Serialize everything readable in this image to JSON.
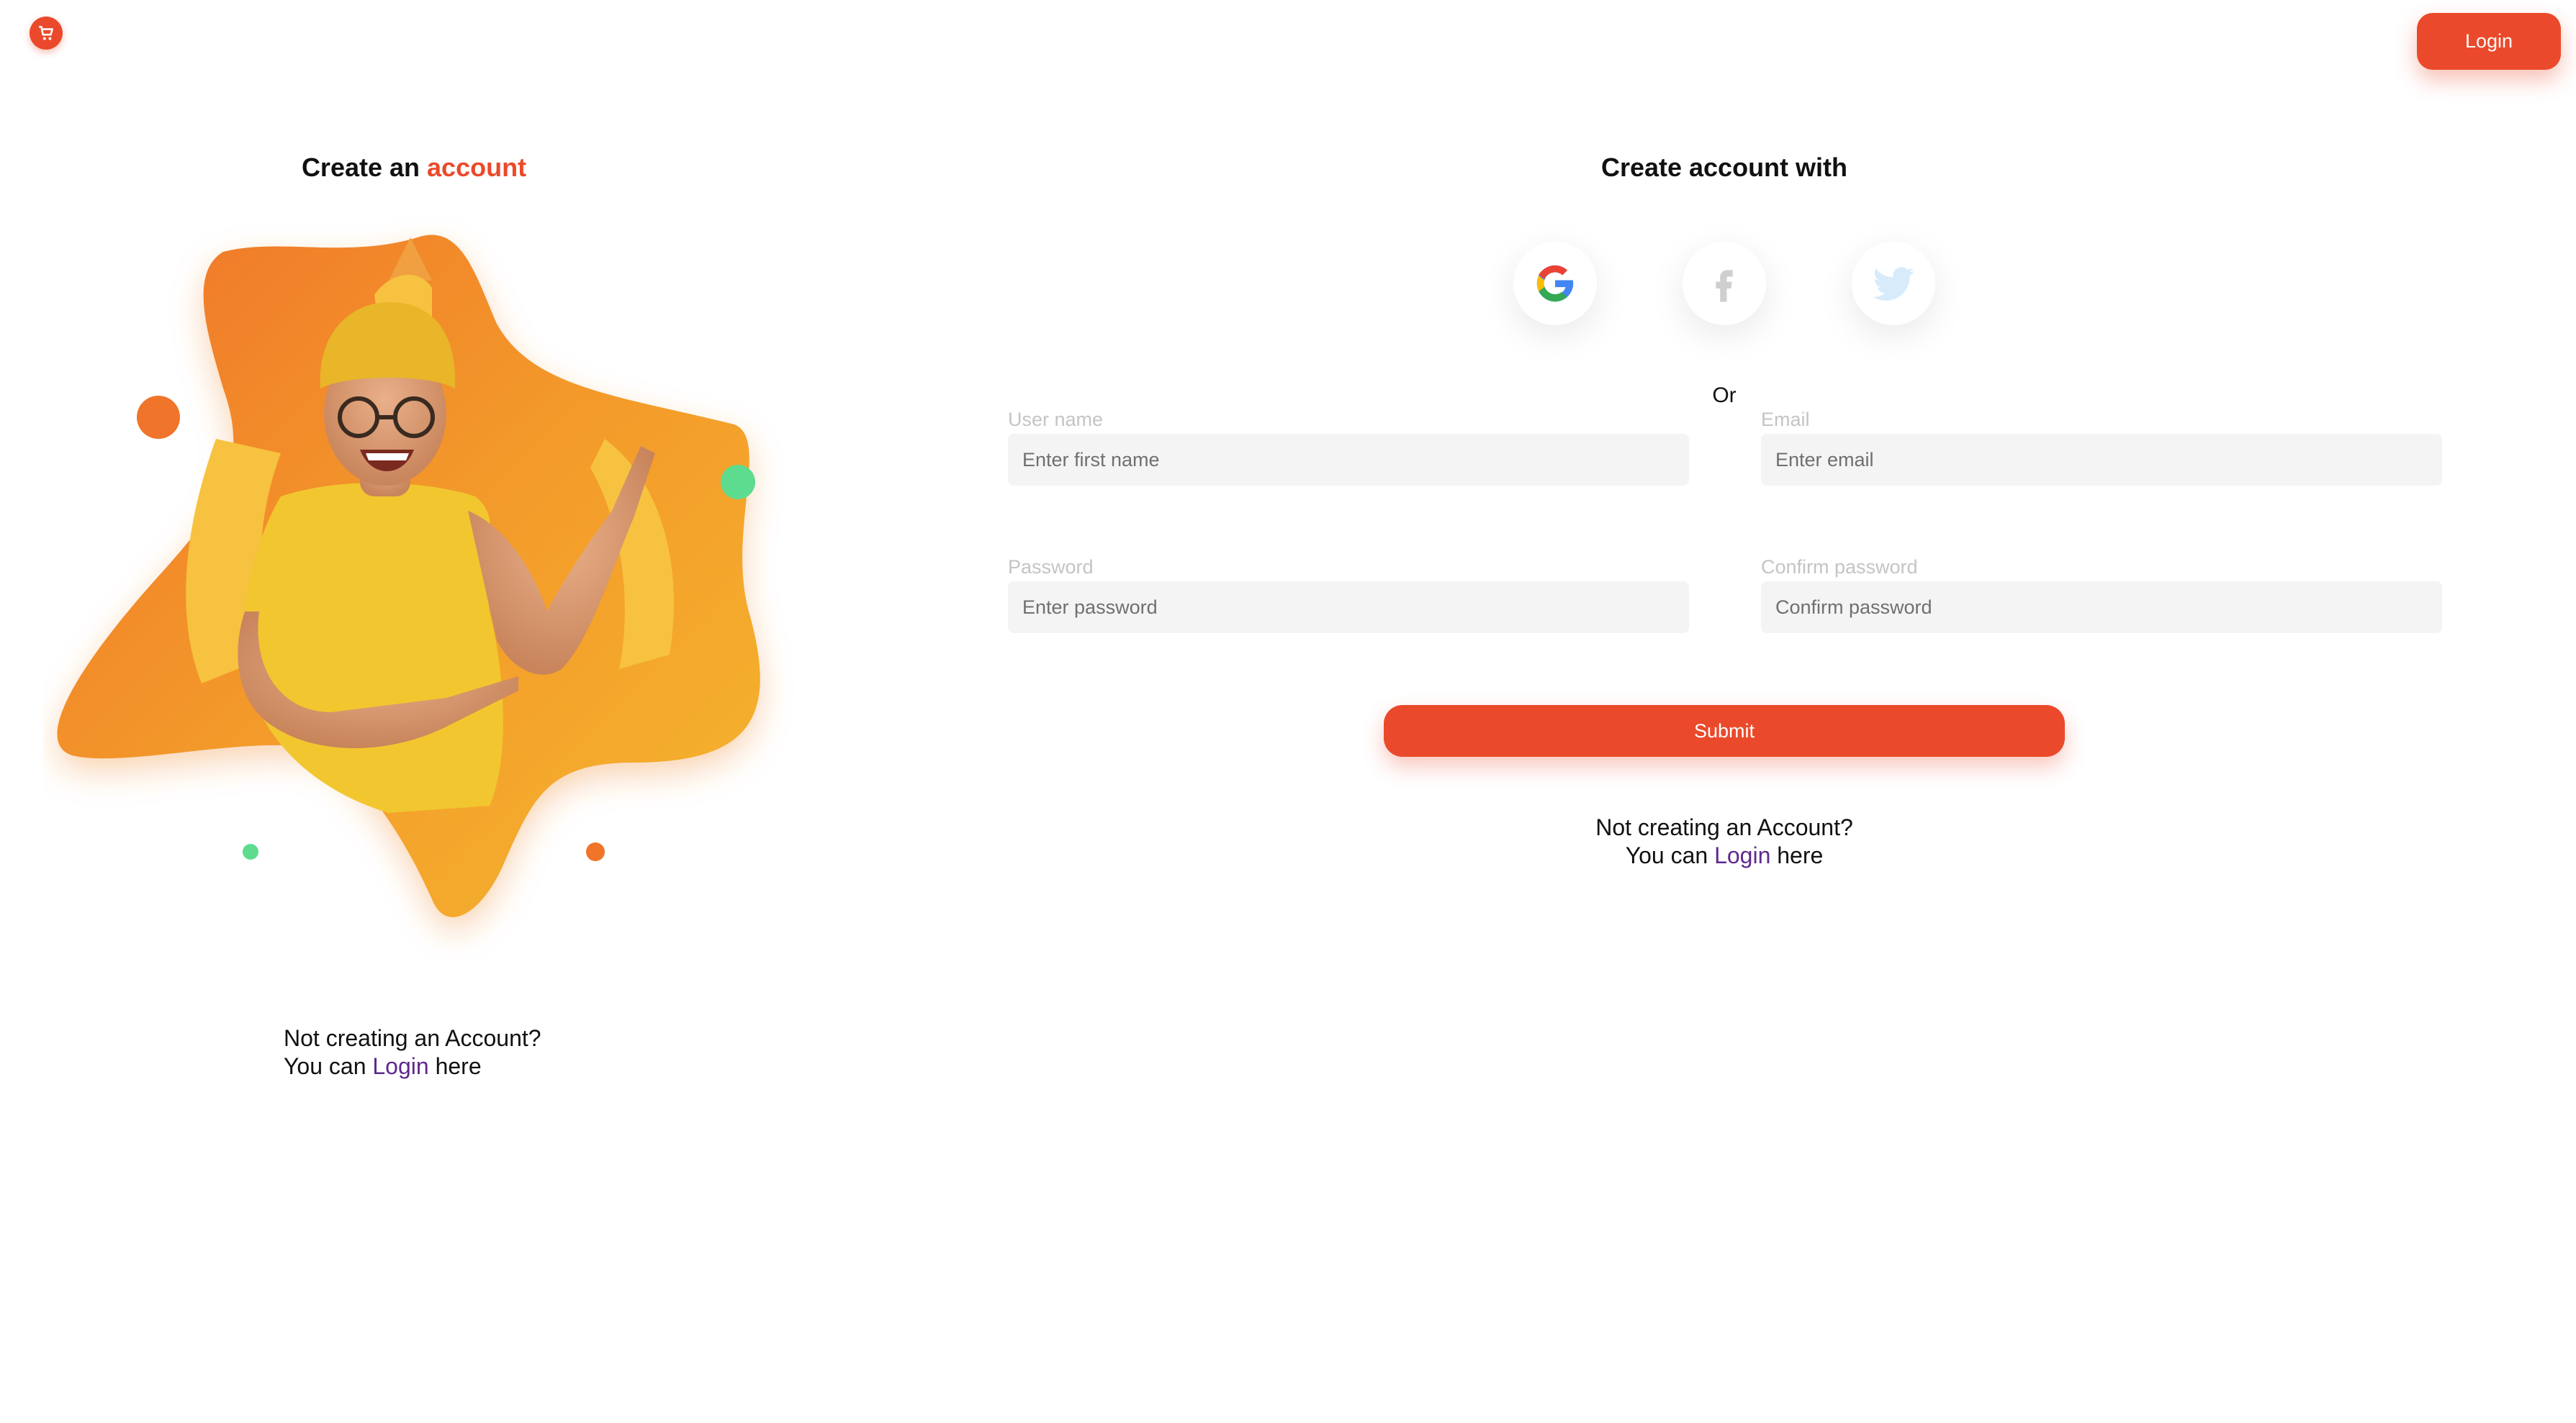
{
  "header": {
    "logo_icon": "cart-icon",
    "login_label": "Login"
  },
  "left": {
    "title_prefix": "Create an",
    "title_accent": "account",
    "hero_image": "smiling-man-pointing-illustration",
    "note_line1": "Not creating an Account?",
    "note_prefix": "You can",
    "note_link": "Login",
    "note_suffix": "here"
  },
  "right": {
    "title": "Create account with",
    "social": [
      {
        "name": "google-icon"
      },
      {
        "name": "facebook-icon"
      },
      {
        "name": "twitter-icon"
      }
    ],
    "or_label": "Or",
    "fields": {
      "username": {
        "label": "User name",
        "placeholder": "Enter first name",
        "value": ""
      },
      "email": {
        "label": "Email",
        "placeholder": "Enter email",
        "value": ""
      },
      "password": {
        "label": "Password",
        "placeholder": "Enter password",
        "value": ""
      },
      "confirm": {
        "label": "Confirm password",
        "placeholder": "Confirm password",
        "value": ""
      }
    },
    "submit_label": "Submit",
    "note_line1": "Not creating an Account?",
    "note_prefix": "You can",
    "note_link": "Login",
    "note_suffix": "here"
  },
  "colors": {
    "accent": "#ea4a2b",
    "link": "#5e2a8c",
    "input_bg": "#f4f4f4",
    "blob_orange": "#f0862a",
    "blob_yellow": "#f5b62d",
    "dot_green": "#5ddc8f"
  }
}
